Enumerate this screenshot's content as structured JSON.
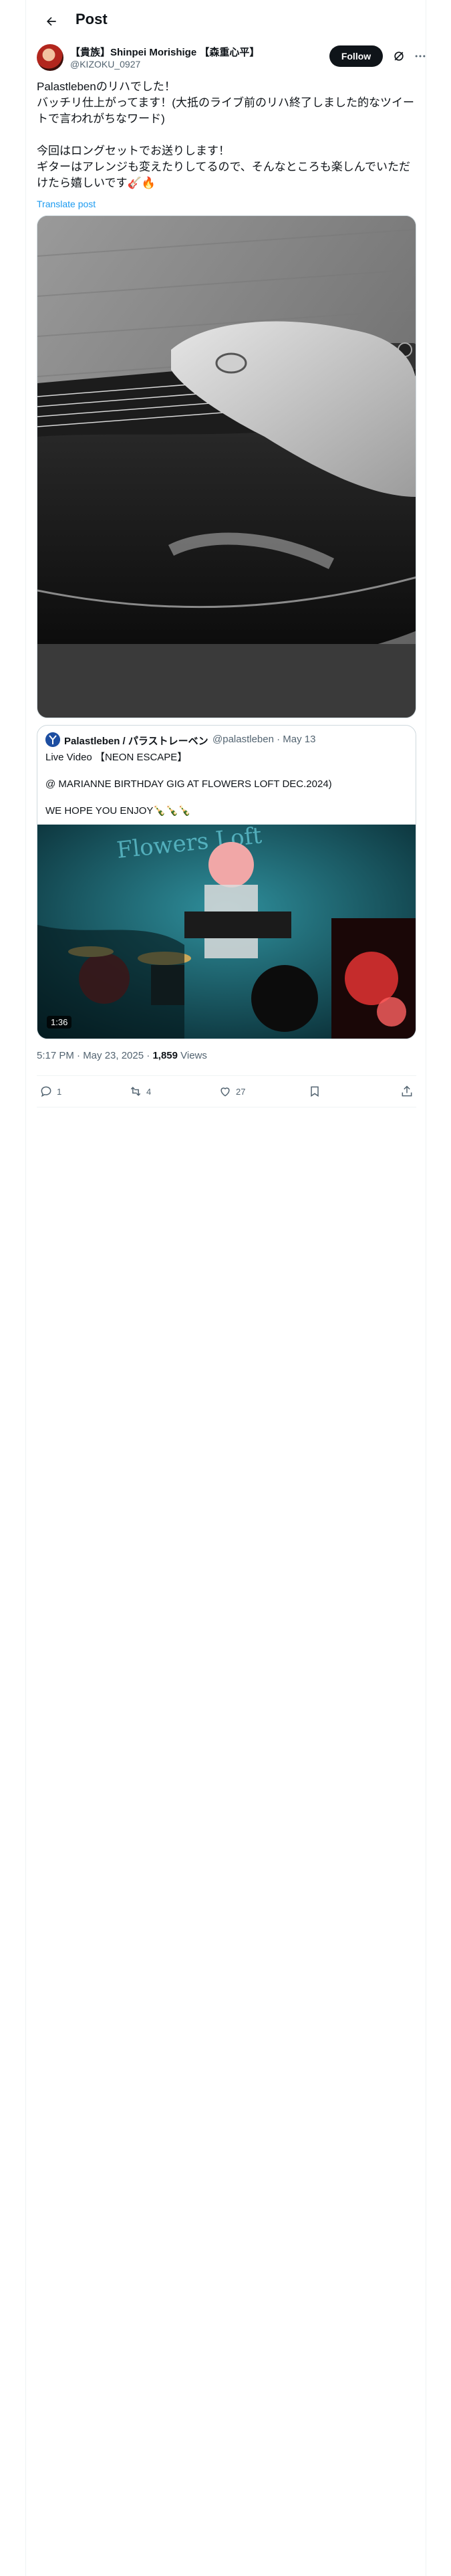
{
  "header": {
    "title": "Post"
  },
  "author": {
    "name": "【貴族】Shinpei Morishige 【森重心平】",
    "handle": "@KIZOKU_0927",
    "follow_label": "Follow"
  },
  "post": {
    "lines": [
      "Palastlebenのリハでした！",
      "バッチリ仕上がってます！(大抵のライブ前のリハ終了しました的なツイー",
      "トで言われがちなワード)",
      "",
      "今回はロングセットでお送りします！",
      "ギターはアレンジも変えたりしてるので、そんなところも楽しんでいただ",
      "けたら嬉しいです🎸🔥"
    ],
    "translate_label": "Translate post",
    "timestamp": "5:17 PM · May 23, 2025",
    "views_count": "1,859",
    "views_label": " Views"
  },
  "quote": {
    "name": "Palastleben / パラストレーベン",
    "handle": "@palastleben · May 13",
    "lines": [
      "Live Video 【NEON ESCAPE】",
      "",
      "@ MARIANNE BIRTHDAY GIG AT FLOWERS LOFT DEC.2024)",
      "",
      "WE HOPE YOU ENJOY🍾🍾🍾"
    ],
    "video_duration": "1:36",
    "video_sign_text": "Flowers Loft"
  },
  "actions": {
    "reply_count": "1",
    "repost_count": "4",
    "like_count": "27"
  },
  "icons": [
    "back-arrow-icon",
    "grok-icon",
    "more-icon",
    "reply-icon",
    "repost-icon",
    "like-icon",
    "bookmark-icon",
    "share-icon"
  ],
  "colors": {
    "accent": "#1d9bf0",
    "text": "#0f1419",
    "secondary": "#536471",
    "border": "#cfd9de"
  }
}
